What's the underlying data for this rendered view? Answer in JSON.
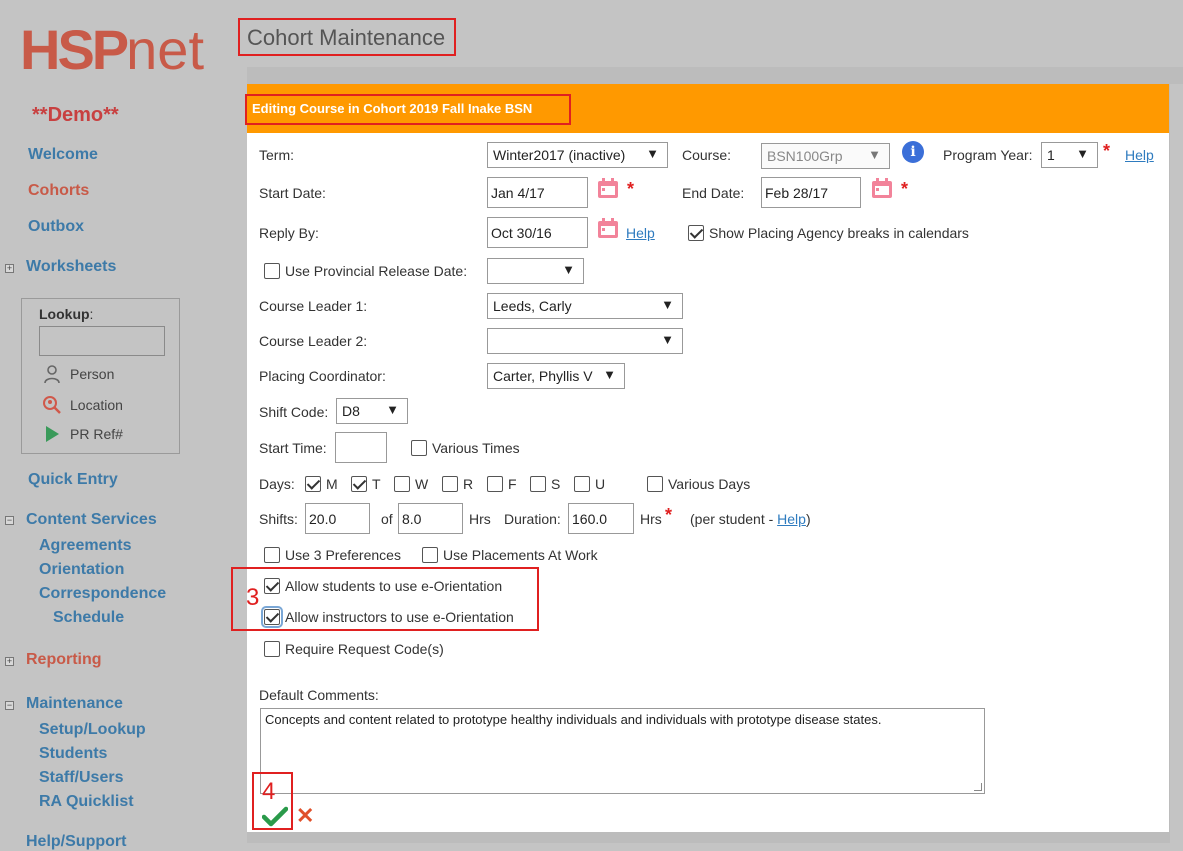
{
  "logo": {
    "part1": "HSP",
    "part2": "net"
  },
  "sidebar": {
    "demo": "**Demo**",
    "welcome": "Welcome",
    "cohorts": "Cohorts",
    "outbox": "Outbox",
    "worksheets": "Worksheets",
    "lookup_label": "Lookup",
    "lookup_colon": ":",
    "person": "Person",
    "location": "Location",
    "pr_ref": "PR Ref#",
    "quick_entry": "Quick Entry",
    "content_services": "Content Services",
    "agreements": "Agreements",
    "orientation": "Orientation",
    "correspondence": "Correspondence",
    "schedule": "Schedule",
    "reporting": "Reporting",
    "maintenance": "Maintenance",
    "setup_lookup": "Setup/Lookup",
    "students": "Students",
    "staff_users": "Staff/Users",
    "ra_quicklist": "RA Quicklist",
    "help_support": "Help/Support"
  },
  "header": {
    "title": "Cohort Maintenance"
  },
  "dialog": {
    "title": "Editing Course in Cohort 2019 Fall Inake BSN",
    "term_label": "Term:",
    "term_value": "Winter2017 (inactive)",
    "course_label": "Course:",
    "course_value": "BSN100Grp",
    "program_year_label": "Program Year:",
    "program_year_value": "1",
    "help": "Help",
    "start_date_label": "Start Date:",
    "start_date_value": "Jan 4/17",
    "end_date_label": "End Date:",
    "end_date_value": "Feb 28/17",
    "reply_by_label": "Reply By:",
    "reply_by_value": "Oct 30/16",
    "show_breaks_label": "Show Placing Agency breaks in calendars",
    "provincial_release_label": "Use Provincial Release Date:",
    "course_leader1_label": "Course Leader 1:",
    "course_leader1_value": "Leeds, Carly",
    "course_leader2_label": "Course Leader 2:",
    "course_leader2_value": "",
    "placing_coord_label": "Placing Coordinator:",
    "placing_coord_value": "Carter, Phyllis V",
    "shift_code_label": "Shift Code:",
    "shift_code_value": "D8",
    "start_time_label": "Start Time:",
    "various_times_label": "Various Times",
    "days_label": "Days:",
    "days": [
      "M",
      "T",
      "W",
      "R",
      "F",
      "S",
      "U"
    ],
    "various_days_label": "Various Days",
    "shifts_label": "Shifts:",
    "shifts_value": "20.0",
    "of_label": "of",
    "hrs_value": "8.0",
    "hrs_label": "Hrs",
    "duration_label": "Duration:",
    "duration_value": "160.0",
    "duration_hrs_label": "Hrs",
    "per_student_prefix": "(per student - ",
    "per_student_help": "Help",
    "per_student_suffix": ")",
    "use3pref_label": "Use 3 Preferences",
    "placements_work_label": "Use Placements At Work",
    "allow_students_label": "Allow students to use e-Orientation",
    "allow_instructors_label": "Allow instructors to use e-Orientation",
    "require_code_label": "Require Request Code(s)",
    "default_comments_label": "Default Comments:",
    "default_comments_value": "Concepts and content related to prototype healthy individuals and individuals with prototype disease states.",
    "step3": "3",
    "step4": "4"
  },
  "colors": {
    "header_orange": "#ff9900",
    "annotation_red": "#e02020",
    "link_blue": "#2e7bbf"
  }
}
